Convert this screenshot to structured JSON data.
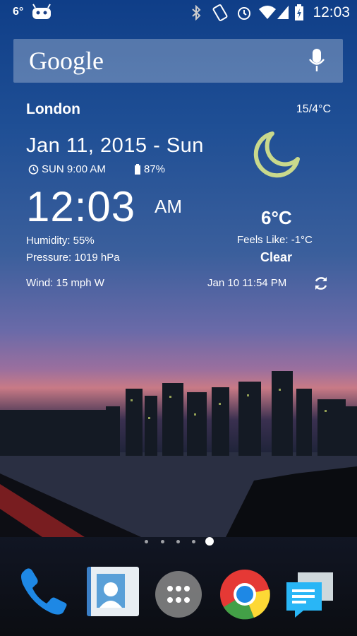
{
  "status_bar": {
    "notification_temp": "6°",
    "time": "12:03",
    "icons": [
      "cyanogen-icon",
      "bluetooth-icon",
      "vibrate-icon",
      "alarm-icon",
      "wifi-icon",
      "signal-icon",
      "battery-charging-icon"
    ]
  },
  "search": {
    "logo": "Google",
    "icon": "mic-icon"
  },
  "weather": {
    "city": "London",
    "high_low": "15/4°C",
    "date": "Jan 11, 2015 - Sun",
    "alarm": "SUN 9:00 AM",
    "battery": "87%",
    "clock": "12:03",
    "ampm": "AM",
    "humidity": "Humidity: 55%",
    "pressure": "Pressure: 1019 hPa",
    "wind": "Wind: 15 mph W",
    "temperature": "6°C",
    "feels_like": "Feels Like: -1°C",
    "condition": "Clear",
    "updated": "Jan 10  11:54 PM",
    "condition_icon": "moon-icon",
    "moon_color": "#c9d98c"
  },
  "page_indicator": {
    "count": 5,
    "current": 5
  },
  "dock": [
    "phone-icon",
    "contacts-icon",
    "app-drawer-icon",
    "chrome-icon",
    "messaging-icon"
  ]
}
